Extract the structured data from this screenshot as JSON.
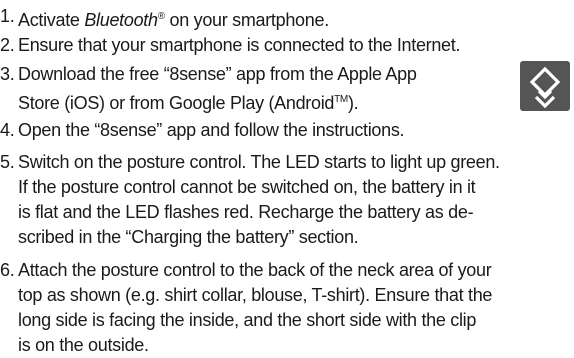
{
  "steps": [
    {
      "number": "1.",
      "lines": [
        {
          "pre": "Activate ",
          "italic": "Bluetooth",
          "sup": "®",
          "post": " on your smartphone."
        }
      ]
    },
    {
      "number": "2.",
      "lines": [
        "Ensure that your smartphone is connected to the Internet."
      ]
    },
    {
      "number": "3.",
      "lines": [
        "Download the free “8sense” app from the Apple App",
        {
          "pre": "Store (iOS) or from Google Play (Android",
          "sup": "TM",
          "post": ")."
        }
      ]
    },
    {
      "number": "4.",
      "lines": [
        "Open the “8sense” app and follow the instructions."
      ]
    },
    {
      "number": "5.",
      "lines": [
        "Switch on the posture control. The LED starts to light up green.",
        "If the posture control cannot be switched on, the battery in it",
        "is flat and the LED flashes red. Recharge the battery as de-",
        "scribed in the “Charging the battery” section."
      ]
    },
    {
      "number": "6.",
      "lines": [
        "Attach the posture control to the back of the neck area of your",
        "top as shown (e.g. shirt collar, blouse, T-shirt). Ensure that the",
        "long side is facing the inside, and the short side with the clip",
        "is on the outside."
      ]
    }
  ],
  "app_icon": {
    "icon": "8sense-app-icon",
    "background": "#555555",
    "foreground": "#ffffff"
  }
}
